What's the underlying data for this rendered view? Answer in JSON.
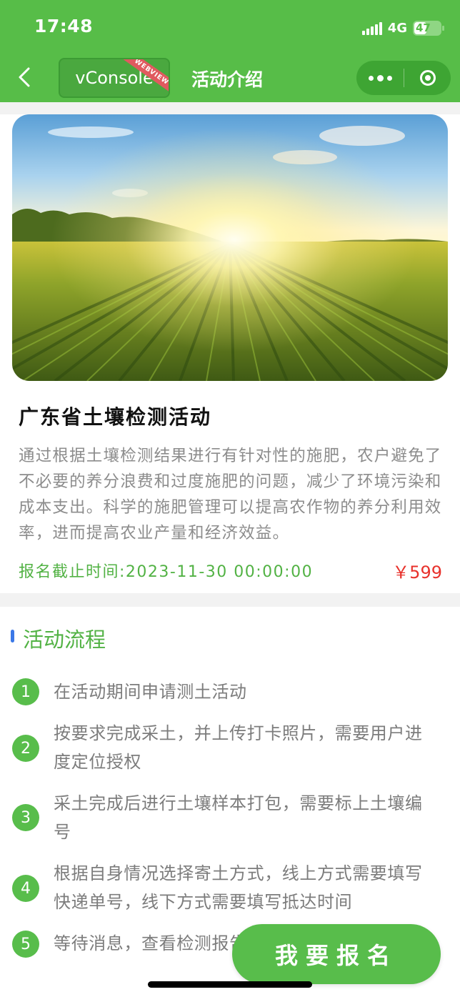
{
  "status_bar": {
    "time": "17:48",
    "network": "4G",
    "battery": "47",
    "battery_level": 0.47
  },
  "nav": {
    "vconsole_label": "vConsole",
    "webview_badge": "WEBVIEW",
    "title": "活动介绍"
  },
  "activity": {
    "title": "广东省土壤检测活动",
    "description": "通过根据土壤检测结果进行有针对性的施肥，农户避免了不必要的养分浪费和过度施肥的问题，减少了环境污染和成本支出。科学的施肥管理可以提高农作物的养分利用效率，进而提高农业产量和经济效益。",
    "deadline": "报名截止时间:2023-11-30 00:00:00",
    "price": "￥599"
  },
  "flow": {
    "title": "活动流程",
    "steps": [
      {
        "num": "1",
        "text": "在活动期间申请测土活动"
      },
      {
        "num": "2",
        "text": "按要求完成采土，并上传打卡照片，需要用户进度定位授权"
      },
      {
        "num": "3",
        "text": "采土完成后进行土壤样本打包，需要标上土壤编号"
      },
      {
        "num": "4",
        "text": "根据自身情况选择寄土方式，线上方式需要填写快递单号，线下方式需要填写抵达时间"
      },
      {
        "num": "5",
        "text": "等待消息，查看检测报告"
      }
    ]
  },
  "signup_button": "我要报名",
  "colors": {
    "brand_green": "#57bd48",
    "text_green": "#52b244",
    "price_red": "#e8322c",
    "accent_blue": "#3b78e7"
  }
}
